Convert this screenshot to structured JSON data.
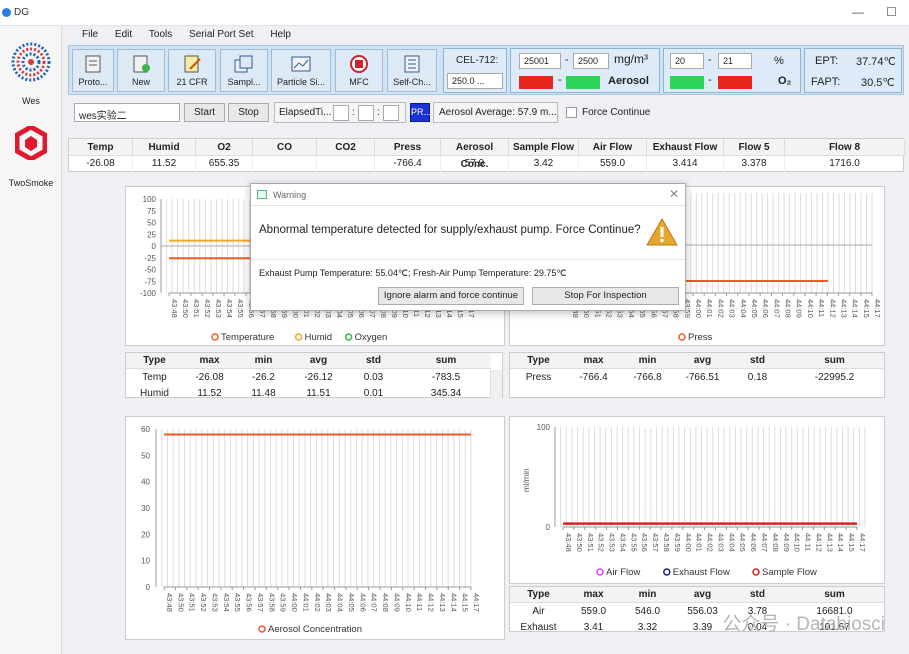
{
  "window": {
    "title": "DG"
  },
  "menu": [
    "File",
    "Edit",
    "Tools",
    "Serial Port Set",
    "Help"
  ],
  "sidebar": [
    {
      "label": "Wes"
    },
    {
      "label": "TwoSmoke"
    }
  ],
  "toolbar": {
    "buttons": [
      "Proto...",
      "New",
      "21 CFR",
      "Sampl...",
      "Particle Si...",
      "MFC",
      "Self-Ch..."
    ],
    "cel_label": "CEL-712:",
    "cel_value": "250.0 ...",
    "aerosol": {
      "min": "25001",
      "max": "2500",
      "unit": "mg/m³",
      "name": "Aerosol"
    },
    "o2": {
      "min": "20",
      "max": "21",
      "unit": "%",
      "name": "O₂"
    },
    "ept_label": "EPT:",
    "ept_value": "37.74℃",
    "fapt_label": "FAPT:",
    "fapt_value": "30.5℃"
  },
  "controls": {
    "experiment": "wes实验二",
    "start": "Start",
    "stop": "Stop",
    "elapsed": "ElapsedTi...",
    "pr": "PR...",
    "aerosol_avg": "Aerosol Average:  57.9 m...",
    "force": "Force Continue"
  },
  "table": {
    "headers": [
      "Temp",
      "Humid",
      "O2",
      "CO",
      "CO2",
      "Press",
      "Aerosol Conc.",
      "Sample Flow",
      "Air Flow",
      "Exhaust Flow",
      "Flow 5",
      "Flow 8"
    ],
    "values": [
      "-26.08",
      "11.52",
      "655.35",
      "",
      "",
      "-766.4",
      "57.9",
      "3.42",
      "559.0",
      "3.414",
      "3.378",
      "1716.0"
    ]
  },
  "charts": {
    "time_ticks": [
      "43:48",
      "43:50",
      "43:51",
      "43:52",
      "43:53",
      "43:54",
      "43:55",
      "43:56",
      "43:57",
      "43:58",
      "43:59",
      "44:00",
      "44:01",
      "44:02",
      "44:03",
      "44:04",
      "44:05",
      "44:06",
      "44:07",
      "44:08",
      "44:09",
      "44:10",
      "44:11",
      "44:12",
      "44:13",
      "44:14",
      "44:15",
      "44:17"
    ],
    "chart1_y": [
      "100",
      "75",
      "50",
      "25",
      "0",
      "-25",
      "-50",
      "-75",
      "-100"
    ],
    "chart1_legend": [
      "Temperature",
      "Humid",
      "Oxygen"
    ],
    "chart2_legend": [
      "Press"
    ],
    "chart3_y": [
      "60",
      "50",
      "40",
      "30",
      "20",
      "10",
      "0"
    ],
    "chart3_legend": [
      "Aerosol Concentration"
    ],
    "chart4_y": [
      "100",
      "0"
    ],
    "chart4_ylabel": "ml/min",
    "chart4_legend": [
      "Air Flow",
      "Exhaust Flow",
      "Sample Flow"
    ]
  },
  "chart_data": [
    {
      "type": "line",
      "ylim": [
        -100,
        100
      ],
      "series": [
        {
          "name": "Temperature",
          "values": [
            -26.08,
            -26.2,
            -26.12
          ]
        },
        {
          "name": "Humid",
          "values": [
            11.52,
            11.48,
            11.51
          ]
        },
        {
          "name": "Oxygen",
          "values": []
        }
      ],
      "colors": [
        "#f05a28",
        "#f5a623",
        "#3cb44b"
      ]
    },
    {
      "type": "line",
      "series": [
        {
          "name": "Press",
          "values": [
            -766.4,
            -766.8,
            -766.51
          ]
        }
      ],
      "colors": [
        "#f05a28"
      ]
    },
    {
      "type": "line",
      "ylim": [
        0,
        60
      ],
      "series": [
        {
          "name": "Aerosol Concentration",
          "values": [
            57.9,
            57.9,
            57.9
          ]
        }
      ],
      "colors": [
        "#f05a28"
      ]
    },
    {
      "type": "line",
      "ylim": [
        0,
        100
      ],
      "ylabel": "ml/min",
      "series": [
        {
          "name": "Air Flow",
          "values": [
            3.42,
            3.42,
            3.42
          ]
        },
        {
          "name": "Exhaust Flow",
          "values": [
            3.41,
            3.41,
            3.41
          ]
        },
        {
          "name": "Sample Flow",
          "values": [
            3.42,
            3.42,
            3.42
          ]
        }
      ],
      "colors": [
        "#e040fb",
        "#1a237e",
        "#e02020"
      ]
    }
  ],
  "stats1": {
    "headers": [
      "Type",
      "max",
      "min",
      "avg",
      "std",
      "sum"
    ],
    "rows": [
      [
        "Temp",
        "-26.08",
        "-26.2",
        "-26.12",
        "0.03",
        "-783.5"
      ],
      [
        "Humid",
        "11.52",
        "11.48",
        "11.51",
        "0.01",
        "345.34"
      ]
    ]
  },
  "stats2": {
    "headers": [
      "Type",
      "max",
      "min",
      "avg",
      "std",
      "sum"
    ],
    "rows": [
      [
        "Press",
        "-766.4",
        "-766.8",
        "-766.51",
        "0.18",
        "-22995.2"
      ]
    ]
  },
  "stats4": {
    "headers": [
      "Type",
      "max",
      "min",
      "avg",
      "std",
      "sum"
    ],
    "rows": [
      [
        "Air",
        "559.0",
        "546.0",
        "556.03",
        "3.78",
        "16681.0"
      ],
      [
        "Exhaust",
        "3.41",
        "3.32",
        "3.39",
        "0.04",
        "101.67"
      ]
    ]
  },
  "dialog": {
    "title": "Warning",
    "message": "Abnormal temperature detected for supply/exhaust pump. Force Continue?",
    "detail": "Exhaust Pump Temperature: 55.04℃; Fresh-Air Pump Temperature: 29.75℃",
    "ignore": "Ignore alarm and force continue",
    "stop": "Stop For Inspection"
  },
  "watermark": "公众号 · Databiosci"
}
